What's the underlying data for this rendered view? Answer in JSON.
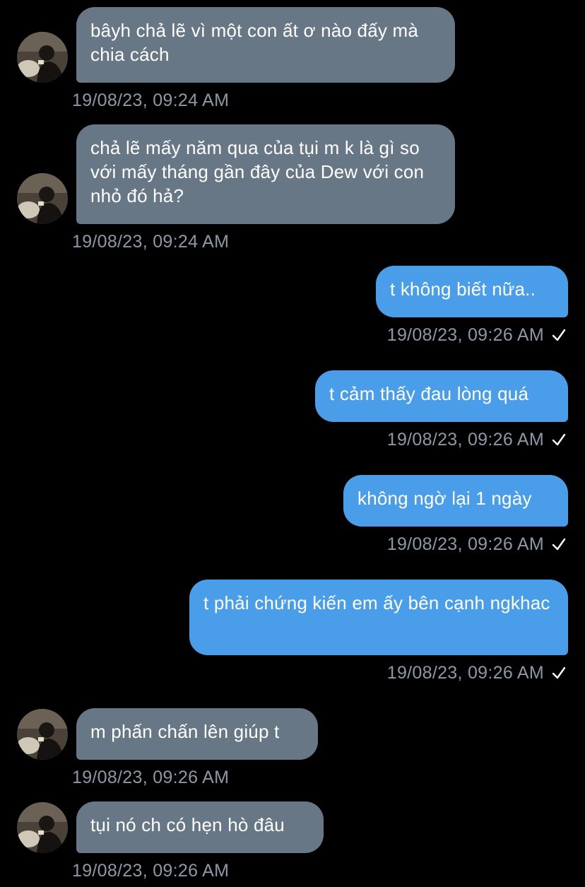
{
  "messages": [
    {
      "direction": "in",
      "text": "bâyh chả lẽ vì một con ất ơ nào đấy mà chia cách",
      "time": "19/08/23, 09:24 AM"
    },
    {
      "direction": "in",
      "text": "chả lẽ mấy năm qua của tụi m k là gì so với mấy tháng gần đây của Dew với con nhỏ đó hả?",
      "time": "19/08/23, 09:24 AM"
    },
    {
      "direction": "out",
      "text": "t không biết nữa..",
      "time": "19/08/23, 09:26 AM",
      "icon": "read-check-icon"
    },
    {
      "direction": "out",
      "text": "t cảm thấy đau lòng quá",
      "time": "19/08/23, 09:26 AM",
      "icon": "read-check-icon"
    },
    {
      "direction": "out",
      "text": "không ngờ lại 1 ngày",
      "time": "19/08/23, 09:26 AM",
      "icon": "read-check-icon"
    },
    {
      "direction": "out",
      "text": "t phải chứng kiến em ấy bên cạnh ngkhac",
      "time": "19/08/23, 09:26 AM",
      "icon": "read-check-icon"
    },
    {
      "direction": "in",
      "text": "m phấn chấn lên giúp t",
      "time": "19/08/23, 09:26 AM"
    },
    {
      "direction": "in",
      "text": "tụi nó ch có hẹn hò đâu",
      "time": "19/08/23, 09:26 AM"
    }
  ],
  "colors": {
    "background": "#000000",
    "incoming_bubble": "#687785",
    "outgoing_bubble": "#4a9ee9",
    "timestamp": "#8b98a5"
  },
  "avatar_icon": "contact-avatar"
}
